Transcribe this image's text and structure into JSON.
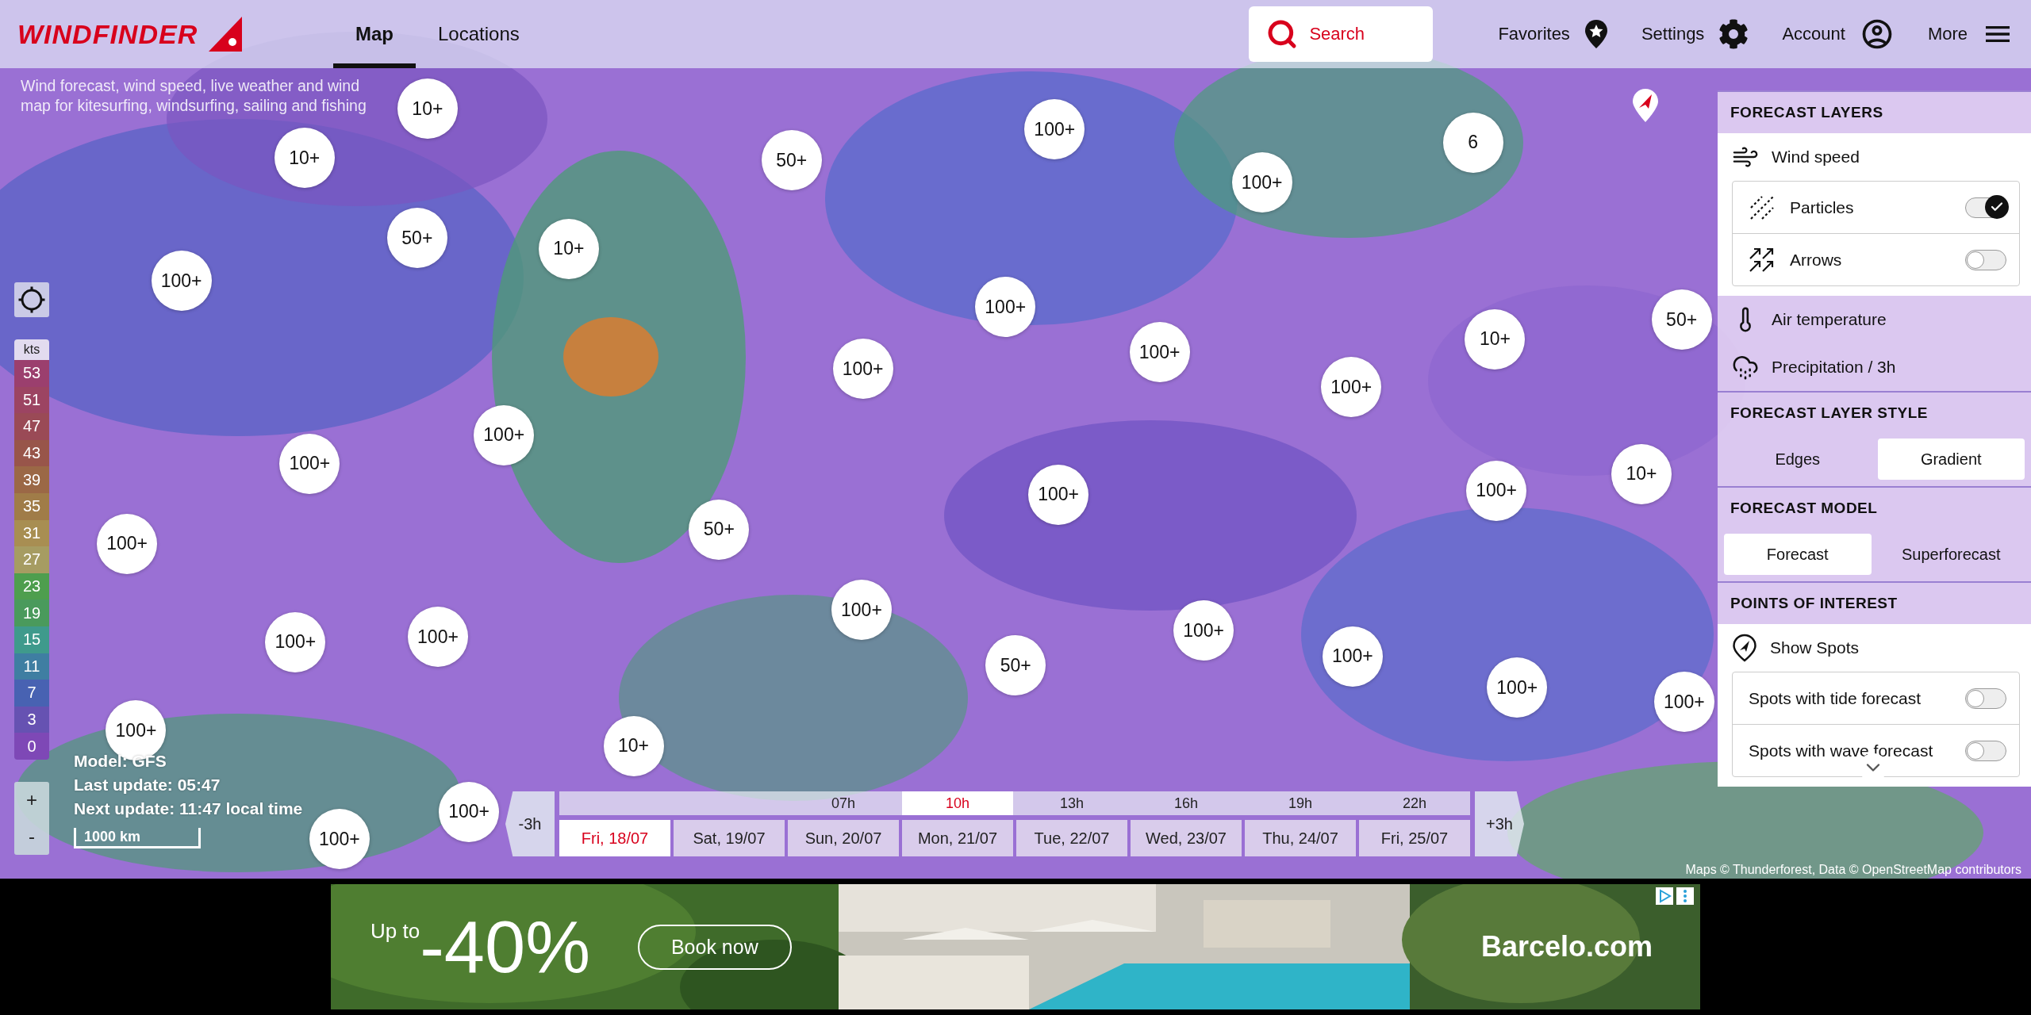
{
  "header": {
    "brand": "WINDFINDER",
    "nav": [
      {
        "label": "Map",
        "selected": true
      },
      {
        "label": "Locations",
        "selected": false
      }
    ],
    "search": {
      "label": "Search"
    },
    "actions": [
      {
        "kind": "favorites",
        "label": "Favorites"
      },
      {
        "kind": "settings",
        "label": "Settings"
      },
      {
        "kind": "account",
        "label": "Account"
      },
      {
        "kind": "more",
        "label": "More"
      }
    ]
  },
  "map": {
    "description": "Wind forecast, wind speed, live weather and wind map for kitesurfing, windsurfing, sailing and fishing",
    "markers": [
      {
        "label": "10+"
      },
      {
        "label": "10+"
      },
      {
        "label": "100+"
      },
      {
        "label": "50+"
      },
      {
        "label": "10+"
      },
      {
        "label": "50+"
      },
      {
        "label": "100+"
      },
      {
        "label": "6"
      },
      {
        "label": "100+"
      },
      {
        "label": "100+"
      },
      {
        "label": "100+"
      },
      {
        "label": "100+"
      },
      {
        "label": "100+"
      },
      {
        "label": "10+"
      },
      {
        "label": "50+"
      },
      {
        "label": "100+"
      },
      {
        "label": "100+"
      },
      {
        "label": "100+"
      },
      {
        "label": "100+"
      },
      {
        "label": "10+"
      },
      {
        "label": "50+"
      },
      {
        "label": "100+"
      },
      {
        "label": "100+"
      },
      {
        "label": "100+"
      },
      {
        "label": "100+"
      },
      {
        "label": "100+"
      },
      {
        "label": "100+"
      },
      {
        "label": "50+"
      },
      {
        "label": "100+"
      },
      {
        "label": "100+"
      },
      {
        "label": "100+"
      },
      {
        "label": "10+"
      },
      {
        "label": "100+"
      },
      {
        "label": "100+"
      }
    ],
    "legend": {
      "unit": "kts",
      "steps": [
        {
          "value": "53",
          "color": "#9b3f6e"
        },
        {
          "value": "51",
          "color": "#9c4462"
        },
        {
          "value": "47",
          "color": "#9a4a56"
        },
        {
          "value": "43",
          "color": "#98554a"
        },
        {
          "value": "39",
          "color": "#9b6846"
        },
        {
          "value": "35",
          "color": "#a07c48"
        },
        {
          "value": "31",
          "color": "#a88e52"
        },
        {
          "value": "27",
          "color": "#a69c62"
        },
        {
          "value": "23",
          "color": "#4e9e4e"
        },
        {
          "value": "19",
          "color": "#4a9a5c"
        },
        {
          "value": "15",
          "color": "#3f9a8c"
        },
        {
          "value": "11",
          "color": "#3f7ea2"
        },
        {
          "value": "7",
          "color": "#4862b2"
        },
        {
          "value": "3",
          "color": "#6652b2"
        },
        {
          "value": "0",
          "color": "#7e48b6"
        }
      ]
    },
    "info": [
      "Model: GFS",
      "Last update: 05:47",
      "Next update: 11:47 local time"
    ],
    "scale": "1000 km",
    "zoom": [
      "+",
      "-"
    ],
    "attribution": "Maps © Thunderforest, Data © OpenStreetMap contributors"
  },
  "timeline": {
    "back": "-3h",
    "forward": "+3h",
    "hours": [
      {
        "label": "07h",
        "selected": false
      },
      {
        "label": "10h",
        "selected": true
      },
      {
        "label": "13h",
        "selected": false
      },
      {
        "label": "16h",
        "selected": false
      },
      {
        "label": "19h",
        "selected": false
      },
      {
        "label": "22h",
        "selected": false
      }
    ],
    "days": [
      {
        "label": "Fri, 18/07",
        "selected": true
      },
      {
        "label": "Sat, 19/07",
        "selected": false
      },
      {
        "label": "Sun, 20/07",
        "selected": false
      },
      {
        "label": "Mon, 21/07",
        "selected": false
      },
      {
        "label": "Tue, 22/07",
        "selected": false
      },
      {
        "label": "Wed, 23/07",
        "selected": false
      },
      {
        "label": "Thu, 24/07",
        "selected": false
      },
      {
        "label": "Fri, 25/07",
        "selected": false
      }
    ]
  },
  "panel": {
    "sections": [
      {
        "kind": "layers",
        "title": "FORECAST LAYERS",
        "items": [
          {
            "label": "Wind speed",
            "selected": true,
            "options": [
              {
                "label": "Particles",
                "on": true
              },
              {
                "label": "Arrows",
                "on": false
              }
            ]
          },
          {
            "label": "Air temperature",
            "selected": false
          },
          {
            "label": "Precipitation / 3h",
            "selected": false
          }
        ]
      },
      {
        "kind": "segmented",
        "title": "FORECAST LAYER STYLE",
        "items": [
          {
            "label": "Edges",
            "selected": false
          },
          {
            "label": "Gradient",
            "selected": true
          }
        ]
      },
      {
        "kind": "segmented",
        "title": "FORECAST MODEL",
        "items": [
          {
            "label": "Forecast",
            "selected": true
          },
          {
            "label": "Superforecast",
            "selected": false
          }
        ]
      },
      {
        "kind": "poi",
        "title": "POINTS OF INTEREST",
        "items": [
          {
            "label": "Show Spots",
            "selected": true,
            "options": [
              {
                "label": "Spots with tide forecast",
                "on": false
              },
              {
                "label": "Spots with wave forecast",
                "on": false
              }
            ]
          }
        ]
      }
    ]
  },
  "ad": {
    "prefix": "Up to",
    "discount": "-40%",
    "cta": "Book now",
    "brand": "Barcelo.com"
  }
}
